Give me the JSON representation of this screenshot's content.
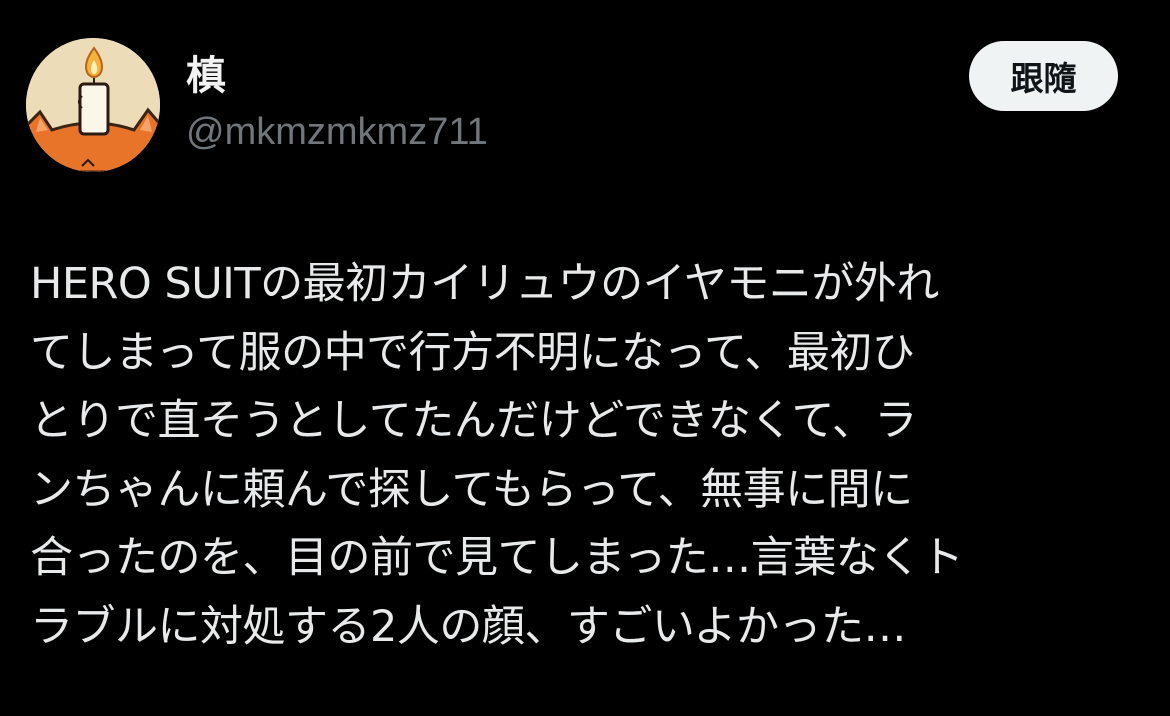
{
  "author": {
    "display_name": "槙",
    "handle": "@mkmzmkmz711",
    "avatar_icon": "candle-cat-avatar"
  },
  "actions": {
    "follow_label": "跟隨"
  },
  "tweet": {
    "text": "HERO SUITの最初カイリュウのイヤモニが外れ\nてしまって服の中で行方不明になって、最初ひ\nとりで直そうとしてたんだけどできなくて、ラ\nンちゃんに頼んで探してもらって、無事に間に\n合ったのを、目の前で見てしまった…言葉なくト\nラブルに対処する2人の顔、すごいよかった…"
  },
  "colors": {
    "background": "#000000",
    "text_primary": "#e7e9ea",
    "text_secondary": "#71767b",
    "button_bg": "#eff3f4",
    "button_text": "#0f1419",
    "avatar_bg": "#ecdcb8",
    "avatar_cat": "#e8742a"
  }
}
